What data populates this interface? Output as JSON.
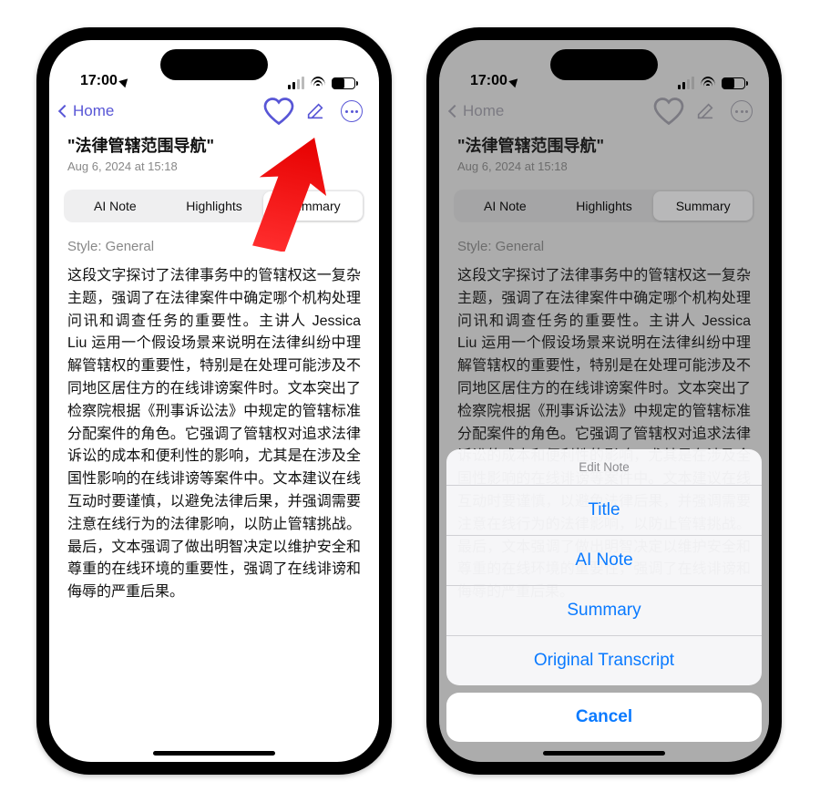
{
  "status": {
    "time": "17:00",
    "loc_icon": "location-arrow"
  },
  "nav": {
    "back_label": "Home"
  },
  "note": {
    "title": "\"法律管辖范围导航\"",
    "date": "Aug 6, 2024 at 15:18"
  },
  "tabs": {
    "ai_note": "AI Note",
    "highlights": "Highlights",
    "summary": "Summary"
  },
  "style_line": "Style: General",
  "body": "这段文字探讨了法律事务中的管辖权这一复杂主题，强调了在法律案件中确定哪个机构处理问讯和调查任务的重要性。主讲人 Jessica Liu 运用一个假设场景来说明在法律纠纷中理解管辖权的重要性，特别是在处理可能涉及不同地区居住方的在线诽谤案件时。文本突出了检察院根据《刑事诉讼法》中规定的管辖标准分配案件的角色。它强调了管辖权对追求法律诉讼的成本和便利性的影响，尤其是在涉及全国性影响的在线诽谤等案件中。文本建议在线互动时要谨慎，以避免法律后果，并强调需要注意在线行为的法律影响，以防止管辖挑战。最后，文本强调了做出明智决定以维护安全和尊重的在线环境的重要性，强调了在线诽谤和侮辱的严重后果。",
  "action_sheet": {
    "header": "Edit Note",
    "items": {
      "title": "Title",
      "ai_note": "AI Note",
      "summary": "Summary",
      "transcript": "Original Transcript"
    },
    "cancel": "Cancel"
  },
  "colors": {
    "accent": "#5856d6",
    "ios_blue": "#0a7aff"
  }
}
